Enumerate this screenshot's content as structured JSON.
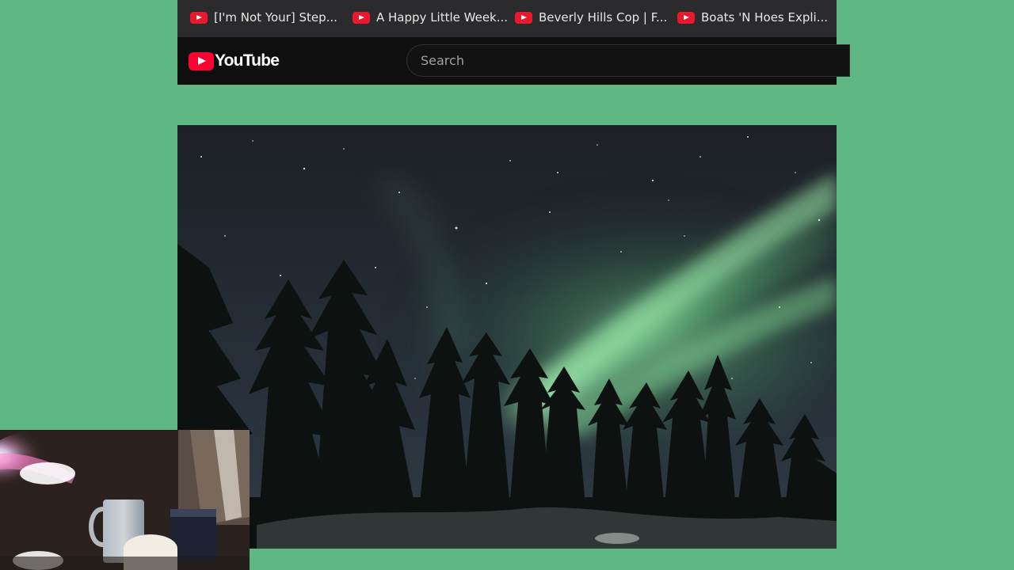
{
  "bookmarks": [
    {
      "label": "[I'm Not Your] Step..."
    },
    {
      "label": "A Happy Little Week..."
    },
    {
      "label": "Beverly Hills Cop | F..."
    },
    {
      "label": "Boats 'N Hoes Expli..."
    }
  ],
  "header": {
    "logo_text": "YouTube",
    "search_placeholder": "Search"
  },
  "colors": {
    "background": "#5fb883",
    "youtube_red": "#ff0033",
    "header_bg": "#0f0f0f",
    "bookmarks_bg": "#2b2b2d"
  },
  "icons": [
    "youtube-favicon-icon",
    "youtube-logo-icon"
  ]
}
